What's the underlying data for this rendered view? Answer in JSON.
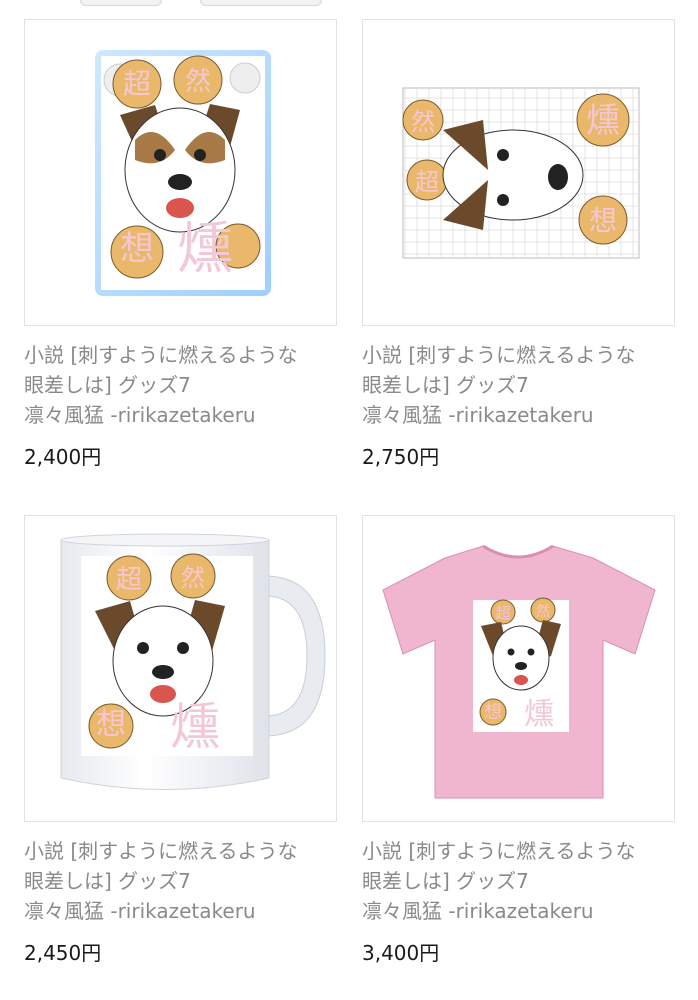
{
  "products": [
    {
      "title_line1": "小説 [刺すように燃えるような",
      "title_line2": "眼差しは] グッズ7",
      "author": "凛々風猛 -ririkazetakeru",
      "price": "2,400円",
      "product_type": "acrylic-stand"
    },
    {
      "title_line1": "小説 [刺すように燃えるような",
      "title_line2": "眼差しは] グッズ7",
      "author": "凛々風猛 -ririkazetakeru",
      "price": "2,750円",
      "product_type": "jigsaw-puzzle"
    },
    {
      "title_line1": "小説 [刺すように燃えるような",
      "title_line2": "眼差しは] グッズ7",
      "author": "凛々風猛 -ririkazetakeru",
      "price": "2,450円",
      "product_type": "mug"
    },
    {
      "title_line1": "小説 [刺すように燃えるような",
      "title_line2": "眼差しは] グッズ7",
      "author": "凛々風猛 -ririkazetakeru",
      "price": "3,400円",
      "product_type": "t-shirt"
    }
  ],
  "artwork": {
    "kanji_top": [
      "超",
      "然"
    ],
    "kanji_bottom": [
      "想",
      "燻"
    ]
  },
  "colors": {
    "title_text": "#8a8a8a",
    "price_text": "#1a1a1a",
    "tshirt": "#f1b6cf",
    "card_border": "#e2e2e2"
  }
}
